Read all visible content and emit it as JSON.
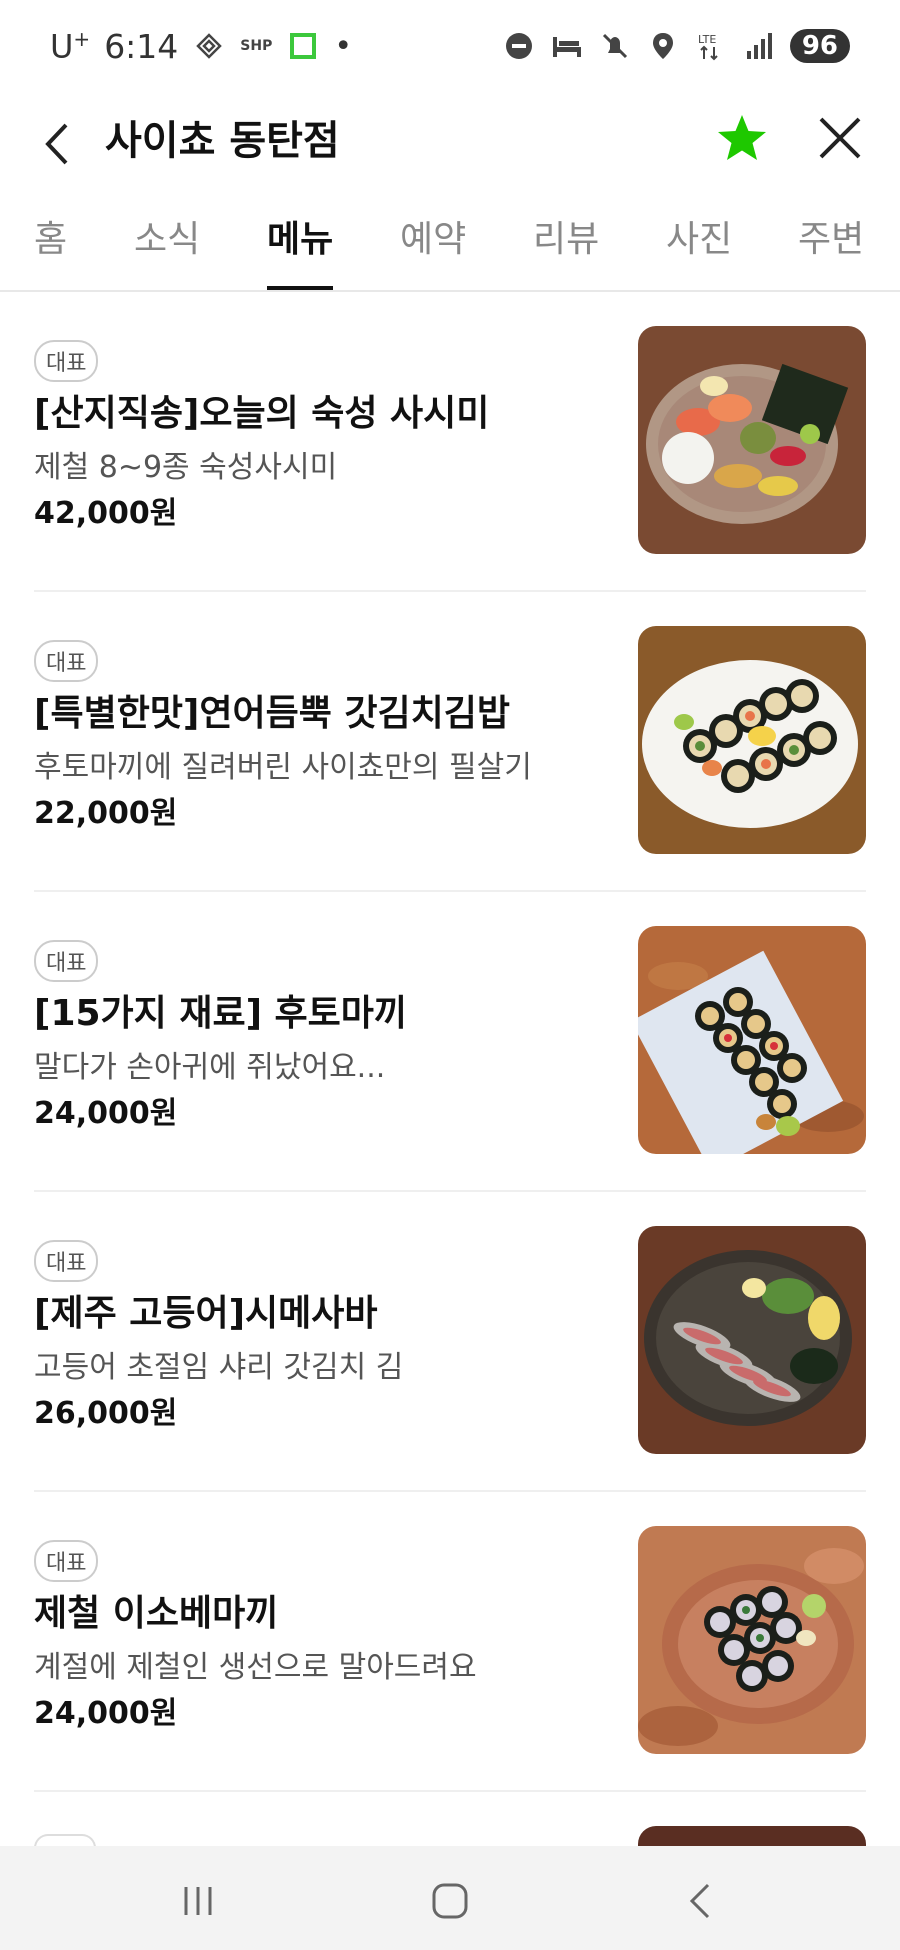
{
  "status_bar": {
    "carrier": "U",
    "carrier_sup": "+",
    "time": "6:14",
    "app_badge": "SHP",
    "battery": "96"
  },
  "header": {
    "title": "사이쵸 동탄점",
    "favorite_color": "#1ec800"
  },
  "tabs": [
    {
      "label": "홈",
      "active": false
    },
    {
      "label": "소식",
      "active": false
    },
    {
      "label": "메뉴",
      "active": true
    },
    {
      "label": "예약",
      "active": false
    },
    {
      "label": "리뷰",
      "active": false
    },
    {
      "label": "사진",
      "active": false
    },
    {
      "label": "주변",
      "active": false
    }
  ],
  "menu": {
    "items": [
      {
        "badge": "대표",
        "name": "[산지직송]오늘의 숙성 사시미",
        "description": "제철 8~9종 숙성사시미",
        "price": "42,000원",
        "image": "sashimi-platter"
      },
      {
        "badge": "대표",
        "name": "[특별한맛]연어듬뿍 갓김치김밥",
        "description": "후토마끼에 질려버린 사이쵸만의 필살기",
        "price": "22,000원",
        "image": "kimbap-plate"
      },
      {
        "badge": "대표",
        "name": "[15가지 재료] 후토마끼",
        "description": "말다가 손아귀에 쥐났어요...",
        "price": "24,000원",
        "image": "futomaki-plate"
      },
      {
        "badge": "대표",
        "name": "[제주 고등어]시메사바",
        "description": "고등어 초절임 샤리 갓김치 김",
        "price": "26,000원",
        "image": "shime-saba-plate"
      },
      {
        "badge": "대표",
        "name": "제철 이소베마끼",
        "description": "계절에 제철인 생선으로 말아드려요",
        "price": "24,000원",
        "image": "isobe-maki-plate"
      }
    ]
  },
  "nav": {
    "recent_icon": "recent-apps-icon",
    "home_icon": "home-icon",
    "back_icon": "back-icon"
  }
}
